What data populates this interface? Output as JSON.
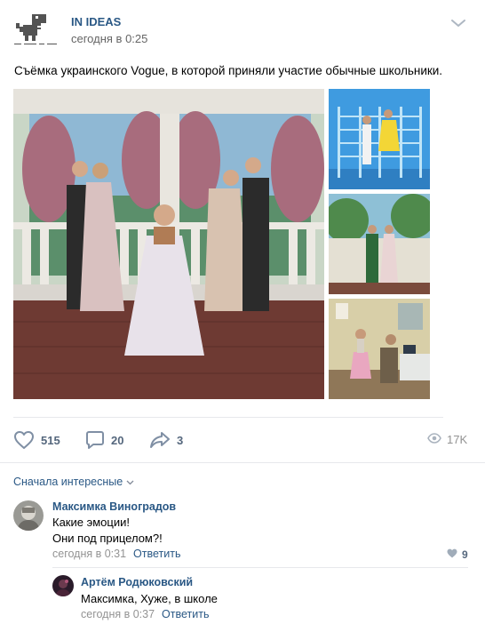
{
  "post": {
    "group_name": "IN IDEAS",
    "time": "сегодня в 0:25",
    "text": "Съёмка украинского Vogue, в которой приняли участие обычные школьники."
  },
  "actions": {
    "likes": "515",
    "comments": "20",
    "shares": "3",
    "views": "17K"
  },
  "comments_sort": "Сначала интересные",
  "comments": [
    {
      "author": "Максимка Виноградов",
      "lines": [
        "Какие эмоции!",
        "Они под прицелом?!"
      ],
      "time": "сегодня в 0:31",
      "reply_label": "Ответить",
      "likes": "9"
    },
    {
      "author": "Артём Родюковский",
      "lines": [
        "Максимка, Хуже, в школе"
      ],
      "time": "сегодня в 0:37",
      "reply_label": "Ответить"
    }
  ],
  "icons": {
    "avatar": "pixel-dinosaur-icon",
    "more": "chevron-down-icon",
    "like": "heart-icon",
    "comment": "comment-bubble-icon",
    "share": "share-arrow-icon",
    "views": "eye-icon"
  },
  "colors": {
    "link": "#2a5885",
    "meta": "#939393",
    "action": "#55677d",
    "separator": "#e7e8ec"
  }
}
